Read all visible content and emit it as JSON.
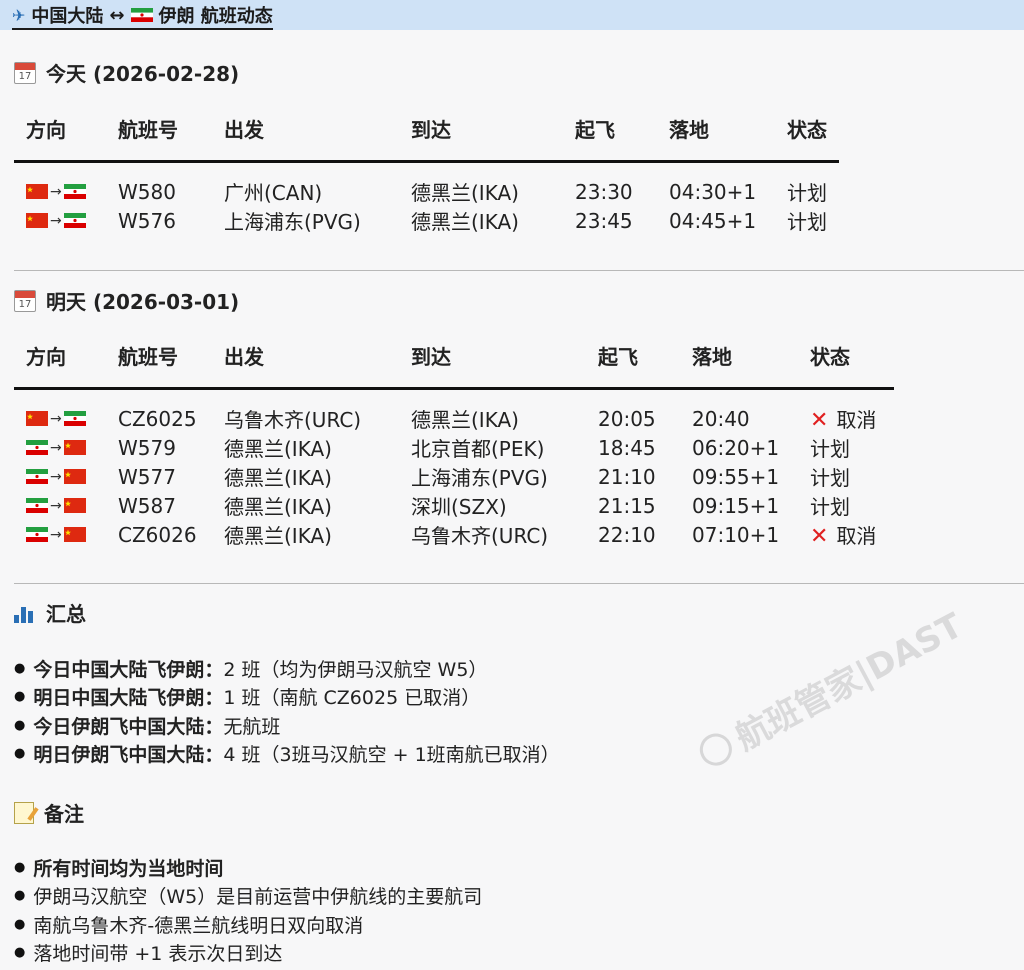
{
  "header": {
    "title_left": "中国大陆",
    "arrow": "↔",
    "title_right": "伊朗 航班动态",
    "plane_icon": "airplane-icon"
  },
  "columns": [
    "方向",
    "航班号",
    "出发",
    "到达",
    "起飞",
    "落地",
    "状态"
  ],
  "today": {
    "heading": "今天 (2026-02-28)",
    "calendar_day": "17",
    "rows": [
      {
        "dir": "cn-ir",
        "flight": "W580",
        "from": "广州(CAN)",
        "to": "德黑兰(IKA)",
        "dep": "23:30",
        "arr": "04:30+1",
        "status": "计划",
        "cancelled": false
      },
      {
        "dir": "cn-ir",
        "flight": "W576",
        "from": "上海浦东(PVG)",
        "to": "德黑兰(IKA)",
        "dep": "23:45",
        "arr": "04:45+1",
        "status": "计划",
        "cancelled": false
      }
    ]
  },
  "tomorrow": {
    "heading": "明天 (2026-03-01)",
    "calendar_day": "17",
    "rows": [
      {
        "dir": "cn-ir",
        "flight": "CZ6025",
        "from": "乌鲁木齐(URC)",
        "to": "德黑兰(IKA)",
        "dep": "20:05",
        "arr": "20:40",
        "status": "取消",
        "cancelled": true
      },
      {
        "dir": "ir-cn",
        "flight": "W579",
        "from": "德黑兰(IKA)",
        "to": "北京首都(PEK)",
        "dep": "18:45",
        "arr": "06:20+1",
        "status": "计划",
        "cancelled": false
      },
      {
        "dir": "ir-cn",
        "flight": "W577",
        "from": "德黑兰(IKA)",
        "to": "上海浦东(PVG)",
        "dep": "21:10",
        "arr": "09:55+1",
        "status": "计划",
        "cancelled": false
      },
      {
        "dir": "ir-cn",
        "flight": "W587",
        "from": "德黑兰(IKA)",
        "to": "深圳(SZX)",
        "dep": "21:15",
        "arr": "09:15+1",
        "status": "计划",
        "cancelled": false
      },
      {
        "dir": "ir-cn",
        "flight": "CZ6026",
        "from": "德黑兰(IKA)",
        "to": "乌鲁木齐(URC)",
        "dep": "22:10",
        "arr": "07:10+1",
        "status": "取消",
        "cancelled": true
      }
    ]
  },
  "summary": {
    "heading": "汇总",
    "items": [
      {
        "label": "今日中国大陆飞伊朗：",
        "text": "2 班（均为伊朗马汉航空 W5）"
      },
      {
        "label": "明日中国大陆飞伊朗：",
        "text": "1 班（南航 CZ6025 已取消）"
      },
      {
        "label": "今日伊朗飞中国大陆：",
        "text": "无航班"
      },
      {
        "label": "明日伊朗飞中国大陆：",
        "text": "4 班（3班马汉航空 + 1班南航已取消）"
      }
    ]
  },
  "notes": {
    "heading": "备注",
    "items": [
      {
        "text": "所有时间均为当地时间",
        "bold": true
      },
      {
        "text": "伊朗马汉航空（W5）是目前运营中伊航线的主要航司",
        "bold": false
      },
      {
        "text": "南航乌鲁木齐-德黑兰航线明日双向取消",
        "bold": false
      },
      {
        "text": "落地时间带 +1 表示次日到达",
        "bold": false
      }
    ]
  },
  "watermark": "航班管家|DAST",
  "colors": {
    "header_bg": "#cfe2f6",
    "cancel": "#e02020",
    "china_red": "#de2910",
    "iran_green": "#239f40",
    "iran_red": "#da0000"
  }
}
